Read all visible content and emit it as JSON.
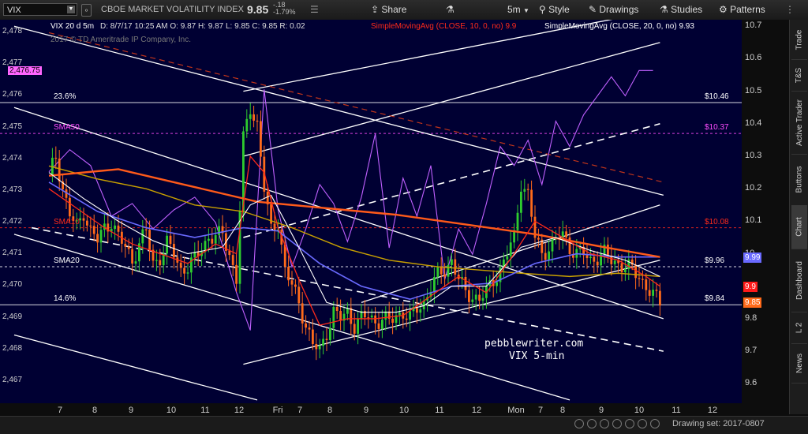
{
  "header": {
    "symbol": "VIX",
    "instrument_name": "CBOE MARKET VOLATILITY INDEX",
    "last": "9.85",
    "net_change": "-.18",
    "pct_change": "-1.79%",
    "buttons": {
      "share": "Share",
      "interval": "5m",
      "style": "Style",
      "drawings": "Drawings",
      "studies": "Studies",
      "patterns": "Patterns"
    }
  },
  "legend": {
    "title": "VIX 20 d 5m",
    "ohlc": "D: 8/7/17 10:25 AM   O: 9.87  H: 9.87  L: 9.85  C: 9.85  R: 0.02",
    "sma10_label": "SimpleMovingAvg (CLOSE, 10, 0, no)",
    "sma10_value": "9.9",
    "sma20_label": "SimpleMovingAvg (CLOSE, 20, 0, no)",
    "sma20_value": "9.93",
    "copyright": "2017 © TD Ameritrade IP Company, Inc."
  },
  "sidebar_tabs": [
    "Trade",
    "T&S",
    "Active Trader",
    "Buttons",
    "Chart",
    "Dashboard",
    "L 2",
    "News"
  ],
  "drawing_set": "Drawing set: 2017-0807",
  "watermark": {
    "line1": "pebblewriter.com",
    "line2": "VIX 5-min"
  },
  "colors": {
    "sma10": "#ff2a1a",
    "sma20": "#ffffff",
    "sma50": "#ff4dff",
    "sma200": "#ff5a1a",
    "up": "#2ecc2e",
    "down": "#ff6a1a",
    "mavg_blue": "#6a6aff",
    "mavg_yellow": "#c8a000"
  },
  "chart_data": {
    "type": "candlestick",
    "x_ticks": [
      "7",
      "8",
      "9",
      "10",
      "11",
      "12",
      "Fri",
      "7",
      "8",
      "9",
      "10",
      "11",
      "12",
      "Mon",
      "7",
      "8",
      "9",
      "10",
      "11",
      "12"
    ],
    "left_axis": {
      "ticks": [
        "2,478",
        "2,477",
        "2,476",
        "2,475",
        "2,474",
        "2,473",
        "2,472",
        "2,471",
        "2,470",
        "2,469",
        "2,468",
        "2,467"
      ],
      "highlight": "2,476.75",
      "ylim": [
        2466.3,
        2478.4
      ]
    },
    "right_axis": {
      "ticks": [
        "10.7",
        "10.6",
        "10.5",
        "10.4",
        "10.3",
        "10.2",
        "10.1",
        "10",
        "9.9",
        "9.8",
        "9.7",
        "9.6"
      ],
      "ylim": [
        9.54,
        10.72
      ]
    },
    "levels": [
      {
        "left_label": "23.6%",
        "right_label": "$10.46",
        "value": 10.465
      },
      {
        "left_label": "SMA50",
        "right_label": "$10.37",
        "value": 10.37
      },
      {
        "left_label": "SMA10",
        "right_label": "$10.08",
        "value": 10.08
      },
      {
        "left_label": "SMA20",
        "right_label": "$9.96",
        "value": 9.96
      },
      {
        "left_label": "14.6%",
        "right_label": "$9.84",
        "value": 9.843
      }
    ],
    "price_tags": [
      {
        "value": 9.99,
        "label": "9.99"
      },
      {
        "value": 9.9,
        "label": "9.9"
      },
      {
        "value": 9.85,
        "label": "9.85"
      }
    ],
    "close_path": [
      [
        0,
        10.24
      ],
      [
        2,
        10.3
      ],
      [
        4,
        10.2
      ],
      [
        6,
        10.12
      ],
      [
        8,
        10.08
      ],
      [
        10,
        10.13
      ],
      [
        12,
        10.07
      ],
      [
        14,
        10.04
      ],
      [
        16,
        10.08
      ],
      [
        18,
        10.1
      ],
      [
        20,
        10.05
      ],
      [
        22,
        10.02
      ],
      [
        24,
        9.98
      ],
      [
        26,
        10.03
      ],
      [
        28,
        10.07
      ],
      [
        30,
        9.97
      ],
      [
        32,
        9.99
      ],
      [
        34,
        10.03
      ],
      [
        36,
        10.0
      ],
      [
        38,
        9.95
      ],
      [
        40,
        9.96
      ],
      [
        42,
        9.98
      ],
      [
        44,
        10.02
      ],
      [
        46,
        10.05
      ],
      [
        48,
        10.05
      ],
      [
        50,
        10.06
      ],
      [
        52,
        10.0
      ],
      [
        54,
        9.92
      ],
      [
        56,
        10.35
      ],
      [
        58,
        10.45
      ],
      [
        60,
        10.4
      ],
      [
        62,
        10.2
      ],
      [
        64,
        10.07
      ],
      [
        66,
        10.1
      ],
      [
        68,
        9.95
      ],
      [
        70,
        9.9
      ],
      [
        72,
        9.85
      ],
      [
        74,
        9.78
      ],
      [
        76,
        9.72
      ],
      [
        78,
        9.7
      ],
      [
        80,
        9.76
      ],
      [
        82,
        9.82
      ],
      [
        84,
        9.8
      ],
      [
        86,
        9.82
      ],
      [
        88,
        9.78
      ],
      [
        90,
        9.8
      ],
      [
        92,
        9.81
      ],
      [
        94,
        9.79
      ],
      [
        96,
        9.8
      ],
      [
        98,
        9.79
      ],
      [
        100,
        9.81
      ],
      [
        102,
        9.82
      ],
      [
        104,
        9.8
      ],
      [
        106,
        9.83
      ],
      [
        108,
        9.85
      ],
      [
        110,
        9.9
      ],
      [
        112,
        9.93
      ],
      [
        114,
        9.95
      ],
      [
        116,
        9.98
      ],
      [
        118,
        9.92
      ],
      [
        120,
        9.88
      ],
      [
        122,
        9.87
      ],
      [
        124,
        9.86
      ],
      [
        126,
        9.88
      ],
      [
        128,
        9.92
      ],
      [
        130,
        9.95
      ],
      [
        132,
        10.0
      ],
      [
        134,
        10.05
      ],
      [
        136,
        10.22
      ],
      [
        138,
        10.18
      ],
      [
        140,
        10.05
      ],
      [
        142,
        10.0
      ],
      [
        144,
        10.02
      ],
      [
        146,
        10.04
      ],
      [
        148,
        10.06
      ],
      [
        150,
        10.02
      ],
      [
        152,
        10.0
      ],
      [
        154,
        10.0
      ],
      [
        156,
        9.98
      ],
      [
        158,
        9.99
      ],
      [
        160,
        10.0
      ],
      [
        162,
        9.98
      ],
      [
        164,
        9.97
      ],
      [
        166,
        9.96
      ],
      [
        168,
        9.95
      ],
      [
        170,
        9.93
      ],
      [
        172,
        9.9
      ],
      [
        174,
        9.87
      ],
      [
        176,
        9.85
      ]
    ],
    "sma10": [
      [
        0,
        10.2
      ],
      [
        8,
        10.14
      ],
      [
        16,
        10.08
      ],
      [
        24,
        10.03
      ],
      [
        32,
        10.0
      ],
      [
        40,
        9.97
      ],
      [
        48,
        10.03
      ],
      [
        54,
        10.0
      ],
      [
        58,
        10.3
      ],
      [
        62,
        10.25
      ],
      [
        66,
        10.08
      ],
      [
        72,
        9.92
      ],
      [
        78,
        9.78
      ],
      [
        86,
        9.8
      ],
      [
        94,
        9.8
      ],
      [
        102,
        9.81
      ],
      [
        110,
        9.87
      ],
      [
        118,
        9.93
      ],
      [
        126,
        9.88
      ],
      [
        134,
        10.0
      ],
      [
        140,
        10.1
      ],
      [
        148,
        10.05
      ],
      [
        156,
        10.0
      ],
      [
        164,
        9.98
      ],
      [
        172,
        9.93
      ],
      [
        176,
        9.9
      ]
    ],
    "sma20": [
      [
        0,
        10.25
      ],
      [
        10,
        10.17
      ],
      [
        20,
        10.1
      ],
      [
        30,
        10.04
      ],
      [
        40,
        10.0
      ],
      [
        50,
        10.02
      ],
      [
        58,
        10.15
      ],
      [
        64,
        10.18
      ],
      [
        72,
        10.02
      ],
      [
        80,
        9.85
      ],
      [
        90,
        9.82
      ],
      [
        100,
        9.82
      ],
      [
        108,
        9.84
      ],
      [
        116,
        9.9
      ],
      [
        126,
        9.9
      ],
      [
        136,
        10.02
      ],
      [
        146,
        10.05
      ],
      [
        156,
        10.01
      ],
      [
        166,
        9.98
      ],
      [
        176,
        9.93
      ]
    ],
    "sma_blue": [
      [
        0,
        10.22
      ],
      [
        14,
        10.13
      ],
      [
        28,
        10.08
      ],
      [
        42,
        10.05
      ],
      [
        56,
        10.08
      ],
      [
        66,
        10.07
      ],
      [
        78,
        9.97
      ],
      [
        90,
        9.9
      ],
      [
        104,
        9.86
      ],
      [
        116,
        9.9
      ],
      [
        128,
        9.91
      ],
      [
        140,
        9.97
      ],
      [
        152,
        10.0
      ],
      [
        164,
        9.99
      ],
      [
        176,
        9.99
      ]
    ],
    "sma_yellow": [
      [
        0,
        10.27
      ],
      [
        14,
        10.23
      ],
      [
        28,
        10.2
      ],
      [
        42,
        10.15
      ],
      [
        56,
        10.13
      ],
      [
        70,
        10.08
      ],
      [
        84,
        10.02
      ],
      [
        98,
        9.98
      ],
      [
        112,
        9.96
      ],
      [
        124,
        9.95
      ],
      [
        136,
        9.94
      ],
      [
        150,
        9.93
      ],
      [
        164,
        9.94
      ],
      [
        176,
        9.93
      ]
    ],
    "sma_orange": [
      [
        0,
        10.24
      ],
      [
        20,
        10.26
      ],
      [
        40,
        10.21
      ],
      [
        60,
        10.16
      ],
      [
        80,
        10.14
      ],
      [
        100,
        10.12
      ],
      [
        120,
        10.09
      ],
      [
        140,
        10.06
      ],
      [
        160,
        10.02
      ],
      [
        176,
        9.99
      ]
    ],
    "es_line": [
      [
        0,
        2473.6
      ],
      [
        6,
        2474.3
      ],
      [
        12,
        2473.8
      ],
      [
        18,
        2472.2
      ],
      [
        24,
        2472.6
      ],
      [
        30,
        2471.8
      ],
      [
        36,
        2472.4
      ],
      [
        42,
        2472.8
      ],
      [
        48,
        2472.0
      ],
      [
        54,
        2469.8
      ],
      [
        58,
        2468.6
      ],
      [
        62,
        2476.2
      ],
      [
        66,
        2472.4
      ],
      [
        70,
        2470.6
      ],
      [
        74,
        2471.8
      ],
      [
        78,
        2473.2
      ],
      [
        82,
        2472.6
      ],
      [
        86,
        2471.4
      ],
      [
        90,
        2472.8
      ],
      [
        94,
        2474.8
      ],
      [
        98,
        2471.2
      ],
      [
        102,
        2473.4
      ],
      [
        106,
        2472.2
      ],
      [
        110,
        2473.8
      ],
      [
        114,
        2470.2
      ],
      [
        118,
        2471.8
      ],
      [
        122,
        2471.0
      ],
      [
        126,
        2472.6
      ],
      [
        130,
        2474.4
      ],
      [
        134,
        2473.8
      ],
      [
        138,
        2474.6
      ],
      [
        142,
        2473.2
      ],
      [
        146,
        2475.2
      ],
      [
        150,
        2474.4
      ],
      [
        154,
        2475.4
      ],
      [
        158,
        2476.0
      ],
      [
        162,
        2476.6
      ],
      [
        166,
        2476.0
      ],
      [
        170,
        2476.8
      ],
      [
        174,
        2476.8
      ]
    ],
    "trendlines": [
      {
        "kind": "solid",
        "from": [
          -10,
          10.7
        ],
        "to": [
          177,
          10.18
        ]
      },
      {
        "kind": "solid",
        "from": [
          -10,
          10.45
        ],
        "to": [
          177,
          9.8
        ]
      },
      {
        "kind": "solid",
        "from": [
          -10,
          10.06
        ],
        "to": [
          150,
          9.55
        ]
      },
      {
        "kind": "solid",
        "from": [
          -10,
          9.75
        ],
        "to": [
          60,
          9.55
        ]
      },
      {
        "kind": "solid",
        "from": [
          56,
          9.66
        ],
        "to": [
          176,
          9.98
        ]
      },
      {
        "kind": "solid",
        "from": [
          56,
          10.5
        ],
        "to": [
          176,
          10.75
        ]
      },
      {
        "kind": "solid",
        "from": [
          56,
          10.3
        ],
        "to": [
          176,
          10.65
        ]
      },
      {
        "kind": "solid",
        "from": [
          90,
          9.85
        ],
        "to": [
          176,
          10.15
        ]
      },
      {
        "kind": "dashed-white",
        "from": [
          56,
          10.05
        ],
        "to": [
          176,
          10.4
        ]
      },
      {
        "kind": "dashed-white",
        "from": [
          -5,
          10.08
        ],
        "to": [
          177,
          9.7
        ]
      },
      {
        "kind": "dashed-red",
        "from": [
          0,
          10.68
        ],
        "to": [
          177,
          10.22
        ]
      }
    ]
  }
}
